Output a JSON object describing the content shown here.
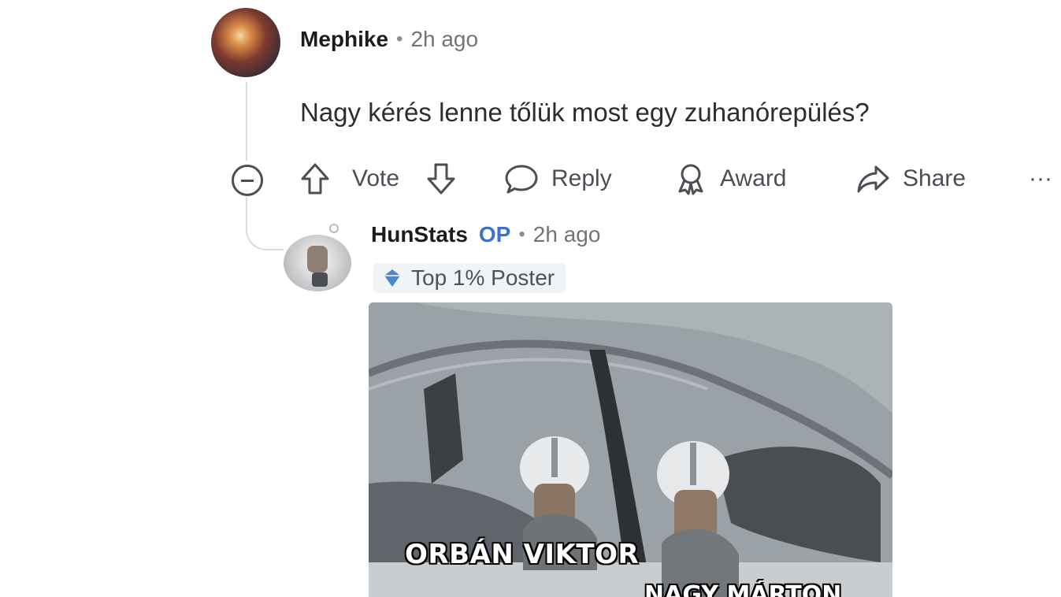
{
  "comment": {
    "username": "Mephike",
    "separator": "•",
    "time": "2h ago",
    "body": "Nagy kérés lenne tőlük most egy zuhanórepülés?",
    "actions": {
      "vote_label": "Vote",
      "reply_label": "Reply",
      "award_label": "Award",
      "share_label": "Share",
      "more_label": "···"
    }
  },
  "reply": {
    "username": "HunStats",
    "op_badge": "OP",
    "separator": "•",
    "time": "2h ago",
    "flair": "Top 1% Poster",
    "meme": {
      "caption_1": "ORBÁN VIKTOR",
      "caption_2": "NAGY MÁRTON"
    }
  },
  "icons": {
    "collapse": "minus-circle-icon",
    "upvote": "arrow-up-icon",
    "downvote": "arrow-down-icon",
    "reply": "speech-bubble-icon",
    "award": "award-ribbon-icon",
    "share": "share-arrow-icon",
    "flair": "diamond-icon"
  },
  "colors": {
    "op_badge": "#3b73c8",
    "text_muted": "#6f757a",
    "action_text": "#4a4f55"
  }
}
